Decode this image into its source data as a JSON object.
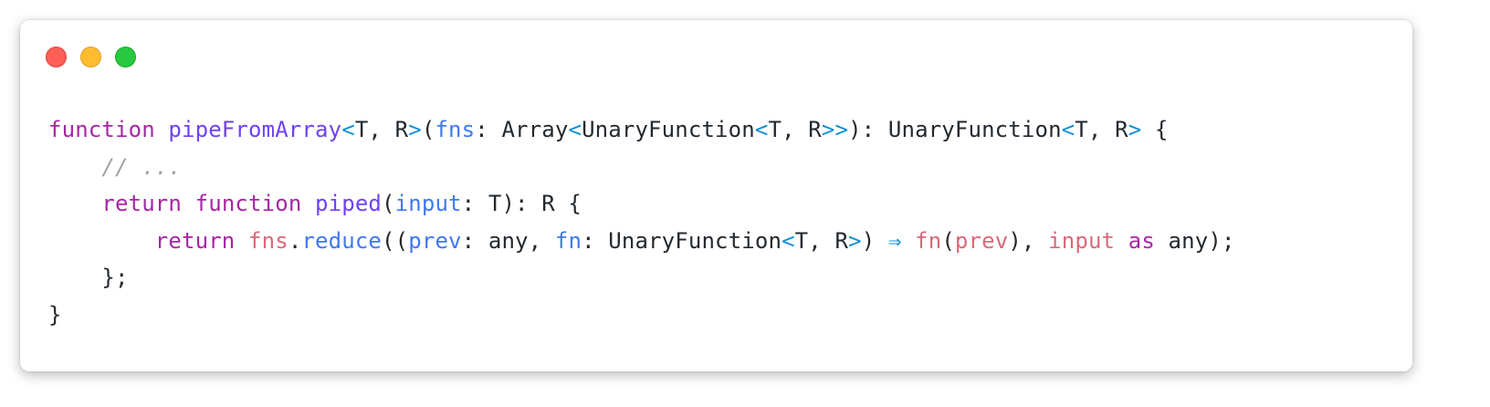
{
  "window": {
    "controls": [
      "close",
      "minimize",
      "maximize"
    ]
  },
  "colors": {
    "keyword": "#a626a4",
    "function_name": "#6f42f1",
    "parameter": "#4078f2",
    "bracket": "#0d8fd6",
    "variable": "#d76a79",
    "comment": "#a0a1a7",
    "text": "#24292e"
  },
  "code": {
    "lines": [
      {
        "tokens": [
          {
            "t": "function",
            "c": "kw"
          },
          {
            "t": " ",
            "c": "pl"
          },
          {
            "t": "pipeFromArray",
            "c": "fn"
          },
          {
            "t": "<",
            "c": "br"
          },
          {
            "t": "T, R",
            "c": "tp"
          },
          {
            "t": ">",
            "c": "br"
          },
          {
            "t": "(",
            "c": "pl"
          },
          {
            "t": "fns",
            "c": "bl"
          },
          {
            "t": ": Array",
            "c": "pl"
          },
          {
            "t": "<",
            "c": "br"
          },
          {
            "t": "UnaryFunction",
            "c": "pl"
          },
          {
            "t": "<",
            "c": "br"
          },
          {
            "t": "T, R",
            "c": "tp"
          },
          {
            "t": ">>",
            "c": "br"
          },
          {
            "t": "): UnaryFunction",
            "c": "pl"
          },
          {
            "t": "<",
            "c": "br"
          },
          {
            "t": "T, R",
            "c": "tp"
          },
          {
            "t": ">",
            "c": "br"
          },
          {
            "t": " {",
            "c": "pl"
          }
        ]
      },
      {
        "tokens": [
          {
            "t": "    ",
            "c": "pl"
          },
          {
            "t": "// ...",
            "c": "cm"
          }
        ]
      },
      {
        "tokens": [
          {
            "t": "    ",
            "c": "pl"
          },
          {
            "t": "return",
            "c": "kw"
          },
          {
            "t": " ",
            "c": "pl"
          },
          {
            "t": "function",
            "c": "kw"
          },
          {
            "t": " ",
            "c": "pl"
          },
          {
            "t": "piped",
            "c": "fn"
          },
          {
            "t": "(",
            "c": "pl"
          },
          {
            "t": "input",
            "c": "bl"
          },
          {
            "t": ": T): R {",
            "c": "pl"
          }
        ]
      },
      {
        "tokens": [
          {
            "t": "        ",
            "c": "pl"
          },
          {
            "t": "return",
            "c": "kw"
          },
          {
            "t": " ",
            "c": "pl"
          },
          {
            "t": "fns",
            "c": "rd"
          },
          {
            "t": ".",
            "c": "pl"
          },
          {
            "t": "reduce",
            "c": "bl"
          },
          {
            "t": "((",
            "c": "pl"
          },
          {
            "t": "prev",
            "c": "bl"
          },
          {
            "t": ": any, ",
            "c": "pl"
          },
          {
            "t": "fn",
            "c": "bl"
          },
          {
            "t": ": UnaryFunction",
            "c": "pl"
          },
          {
            "t": "<",
            "c": "br"
          },
          {
            "t": "T, R",
            "c": "tp"
          },
          {
            "t": ">",
            "c": "br"
          },
          {
            "t": ") ",
            "c": "pl"
          },
          {
            "t": "⇒",
            "c": "br"
          },
          {
            "t": " ",
            "c": "pl"
          },
          {
            "t": "fn",
            "c": "rd"
          },
          {
            "t": "(",
            "c": "pl"
          },
          {
            "t": "prev",
            "c": "rd"
          },
          {
            "t": "), ",
            "c": "pl"
          },
          {
            "t": "input",
            "c": "rd"
          },
          {
            "t": " ",
            "c": "pl"
          },
          {
            "t": "as",
            "c": "kw"
          },
          {
            "t": " any);",
            "c": "pl"
          }
        ]
      },
      {
        "tokens": [
          {
            "t": "    };",
            "c": "pl"
          }
        ]
      },
      {
        "tokens": [
          {
            "t": "}",
            "c": "pl"
          }
        ]
      }
    ]
  }
}
